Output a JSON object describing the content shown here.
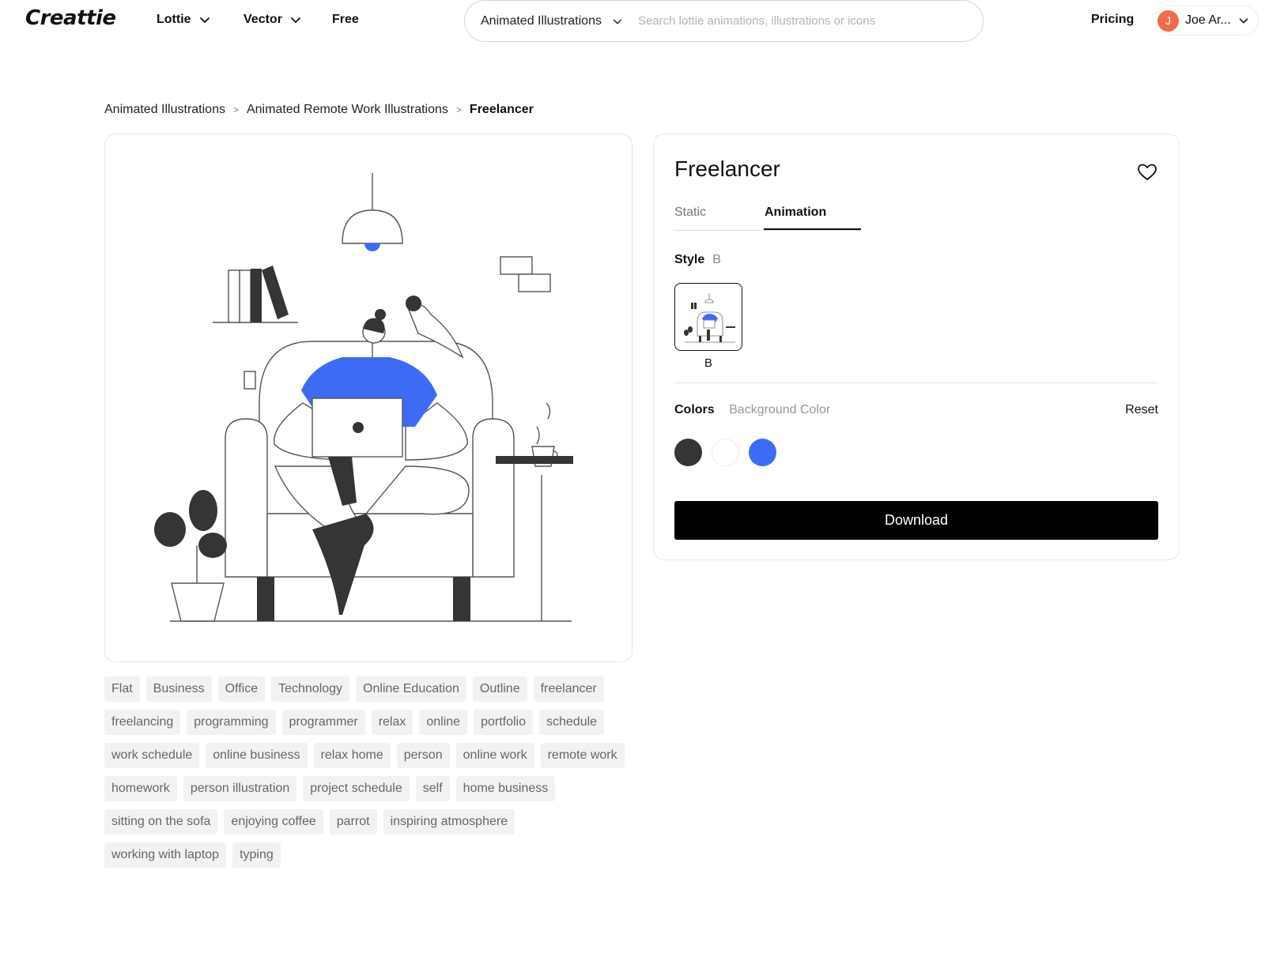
{
  "colors": {
    "accent_blue": "#3d6bf5",
    "dark": "#343636",
    "avatar": "#f26b4b"
  },
  "header": {
    "logo": "Creattie",
    "nav": [
      {
        "label": "Lottie",
        "icon": "chevron-down-icon"
      },
      {
        "label": "Vector",
        "icon": "chevron-down-icon"
      },
      {
        "label": "Free"
      }
    ],
    "search": {
      "category": "Animated Illustrations",
      "placeholder": "Search lottie animations, illustrations or icons"
    },
    "pricing": "Pricing",
    "user": {
      "initial": "J",
      "name": "Joe Ar..."
    }
  },
  "breadcrumb": {
    "items": [
      "Animated Illustrations",
      "Animated Remote Work Illustrations"
    ],
    "separator": ">",
    "current": "Freelancer"
  },
  "details": {
    "title": "Freelancer",
    "tabs": [
      "Static",
      "Animation"
    ],
    "active_tab": "Animation",
    "style_label": "Style",
    "style_value": "B",
    "thumbnail_label": "B",
    "colors_label": "Colors",
    "background_color_label": "Background Color",
    "reset_label": "Reset",
    "swatches": [
      "#343636",
      "#ffffff",
      "#3d6bf5"
    ],
    "download_label": "Download"
  },
  "tags": [
    "Flat",
    "Business",
    "Office",
    "Technology",
    "Online Education",
    "Outline",
    "freelancer",
    "freelancing",
    "programming",
    "programmer",
    "relax",
    "online",
    "portfolio",
    "schedule",
    "work schedule",
    "online business",
    "relax home",
    "person",
    "online work",
    "remote work",
    "homework",
    "person illustration",
    "project schedule",
    "self",
    "home business",
    "sitting on the sofa",
    "enjoying coffee",
    "parrot",
    "inspiring atmosphere",
    "working with laptop",
    "typing"
  ]
}
